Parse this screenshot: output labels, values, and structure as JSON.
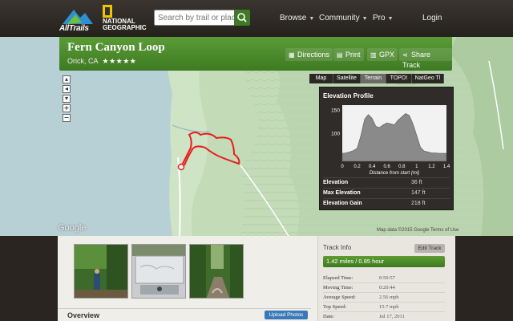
{
  "header": {
    "brand": "AllTrails",
    "partner_line1": "NATIONAL",
    "partner_line2": "GEOGRAPHIC",
    "search_placeholder": "Search by trail or place...",
    "nav": [
      "Browse",
      "Community",
      "Pro",
      "Login"
    ]
  },
  "trail": {
    "title": "Fern Canyon Loop",
    "location": "Orick, CA",
    "stars": "★★★★★",
    "rating": 5,
    "actions": {
      "directions": "Directions",
      "print": "Print",
      "gpx": "GPX",
      "share": "Share Track"
    }
  },
  "map": {
    "tabs": [
      "Map",
      "Satellite",
      "Terrain",
      "TOPO!",
      "NatGeo Tl"
    ],
    "active_tab": "Terrain",
    "google": "Google",
    "attribution": "Map data ©2015 Google  Terms of Use"
  },
  "elevation": {
    "title": "Elevation Profile",
    "xlabel": "Distance from start (mi)",
    "stats": [
      {
        "label": "Elevation",
        "value": "36 ft"
      },
      {
        "label": "Max Elevation",
        "value": "147 ft"
      },
      {
        "label": "Elevation Gain",
        "value": "218 ft"
      }
    ]
  },
  "chart_data": {
    "type": "area",
    "title": "Elevation Profile",
    "xlabel": "Distance from start (mi)",
    "ylabel": "",
    "xlim": [
      0,
      1.4
    ],
    "ylim": [
      40,
      160
    ],
    "xticks": [
      "0",
      "0.2",
      "0.4",
      "0.6",
      "0.8",
      "1",
      "1.2",
      "1.4"
    ],
    "yticks": [
      "100",
      "150"
    ],
    "x": [
      0,
      0.05,
      0.1,
      0.15,
      0.2,
      0.25,
      0.3,
      0.35,
      0.4,
      0.45,
      0.5,
      0.55,
      0.6,
      0.65,
      0.7,
      0.75,
      0.8,
      0.85,
      0.9,
      0.95,
      1.0,
      1.05,
      1.1,
      1.15,
      1.2,
      1.25,
      1.3,
      1.35,
      1.4
    ],
    "values": [
      57,
      58,
      60,
      63,
      68,
      95,
      130,
      140,
      132,
      115,
      112,
      118,
      122,
      120,
      118,
      128,
      135,
      142,
      138,
      120,
      95,
      70,
      62,
      60,
      58,
      58,
      57,
      57,
      57
    ],
    "grid": false
  },
  "photos": [
    "hiker-trail-photo",
    "car-window-photo",
    "creek-canyon-photo"
  ],
  "overview": {
    "title": "Overview",
    "upload": "Upload Photos"
  },
  "track_info": {
    "title": "Track Info",
    "edit": "Edit Track",
    "distance": "1.42 miles / 0.85 hour",
    "stats": [
      {
        "label": "Elapsed Time:",
        "value": "0:50:57"
      },
      {
        "label": "Moving Time:",
        "value": "0:20:44"
      },
      {
        "label": "Average Speed:",
        "value": "2.56 mph"
      },
      {
        "label": "Top Speed:",
        "value": "15.7 mph"
      },
      {
        "label": "Date:",
        "value": "Jul 17, 2011"
      }
    ]
  },
  "colors": {
    "brand_green": "#3f7b26",
    "track_red": "#e81c1c",
    "panel_dark": "#2f2c29",
    "upload_blue": "#3a79b8"
  }
}
